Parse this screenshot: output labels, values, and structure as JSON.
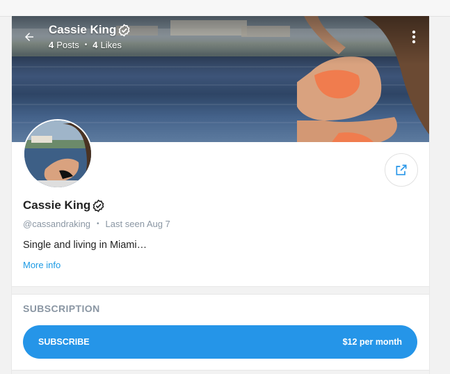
{
  "profile": {
    "name": "Cassie King",
    "handle": "@cassandraking",
    "last_seen": "Last seen Aug 7",
    "bio": "Single and living in Miami…",
    "more_info": "More info"
  },
  "stats": {
    "posts_count": "4",
    "posts_label": "Posts",
    "likes_count": "4",
    "likes_label": "Likes"
  },
  "subscription": {
    "section_title": "SUBSCRIPTION",
    "button_label": "SUBSCRIBE",
    "price": "$12 per month"
  },
  "colors": {
    "accent": "#2595e8",
    "link": "#1b9ae4",
    "muted": "#8a96a3"
  },
  "icons": {
    "back": "arrow-left-icon",
    "verified": "verified-badge-icon",
    "more": "vertical-dots-icon",
    "share": "share-icon"
  }
}
